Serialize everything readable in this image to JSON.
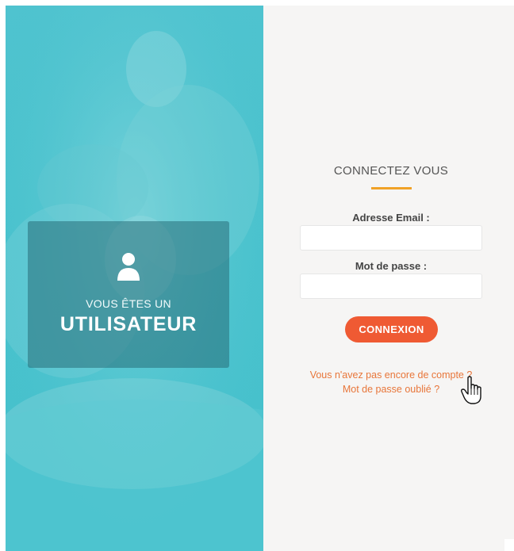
{
  "hero": {
    "subtitle": "VOUS ÊTES UN",
    "title": "UTILISATEUR",
    "icon": "user-icon"
  },
  "login": {
    "title": "CONNECTEZ VOUS",
    "email_label": "Adresse Email :",
    "email_value": "",
    "password_label": "Mot de passe :",
    "password_value": "",
    "submit_label": "CONNEXION",
    "register_link": "Vous n'avez pas encore de compte ?",
    "forgot_link": "Mot de passe oublié ?",
    "cursor_icon": "pointer-hand-icon"
  },
  "colors": {
    "hero_teal": "#4ac2ce",
    "accent_orange": "#ef5a33",
    "underline_gold": "#f0a227",
    "link_orange": "#e8763a",
    "panel_bg": "#f6f5f4"
  }
}
